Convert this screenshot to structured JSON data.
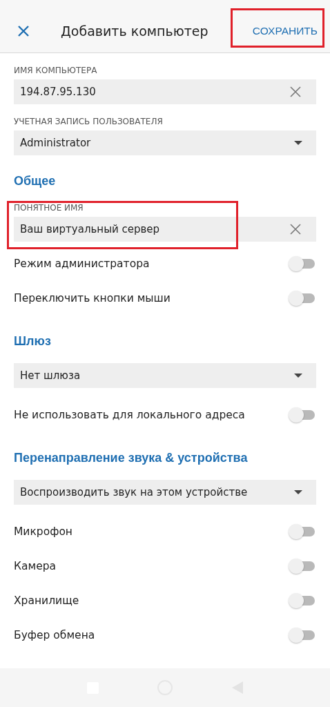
{
  "header": {
    "title": "Добавить компьютер",
    "save_label": "СОХРАНИТЬ",
    "save_highlighted": true
  },
  "items": [
    {
      "kind": "label",
      "text": "ИМЯ КОМПЬЮТЕРА"
    },
    {
      "kind": "field",
      "value": "194.87.95.130",
      "clearable": true,
      "highlighted": false
    },
    {
      "kind": "label",
      "text": "УЧЕТНАЯ ЗАПИСЬ ПОЛЬЗОВАТЕЛЯ"
    },
    {
      "kind": "dropdown",
      "value": "Administrator"
    },
    {
      "kind": "heading",
      "text": "Общее"
    },
    {
      "kind": "label",
      "text": "ПОНЯТНОЕ ИМЯ"
    },
    {
      "kind": "field",
      "value": "Ваш виртуальный сервер",
      "clearable": true,
      "highlighted": true
    },
    {
      "kind": "toggle",
      "text": "Режим администратора",
      "on": false
    },
    {
      "kind": "toggle",
      "text": "Переключить кнопки мыши",
      "on": false
    },
    {
      "kind": "heading",
      "text": "Шлюз"
    },
    {
      "kind": "dropdown",
      "value": "Нет шлюза"
    },
    {
      "kind": "toggle",
      "text": "Не использовать для локального адреса",
      "on": false
    },
    {
      "kind": "heading",
      "text": "Перенаправление звука & устройства"
    },
    {
      "kind": "dropdown",
      "value": "Воспроизводить звук на этом устройстве"
    },
    {
      "kind": "toggle",
      "text": "Микрофон",
      "on": false
    },
    {
      "kind": "toggle",
      "text": "Камера",
      "on": false
    },
    {
      "kind": "toggle",
      "text": "Хранилище",
      "on": false
    },
    {
      "kind": "toggle",
      "text": "Буфер обмена",
      "on": false
    }
  ]
}
